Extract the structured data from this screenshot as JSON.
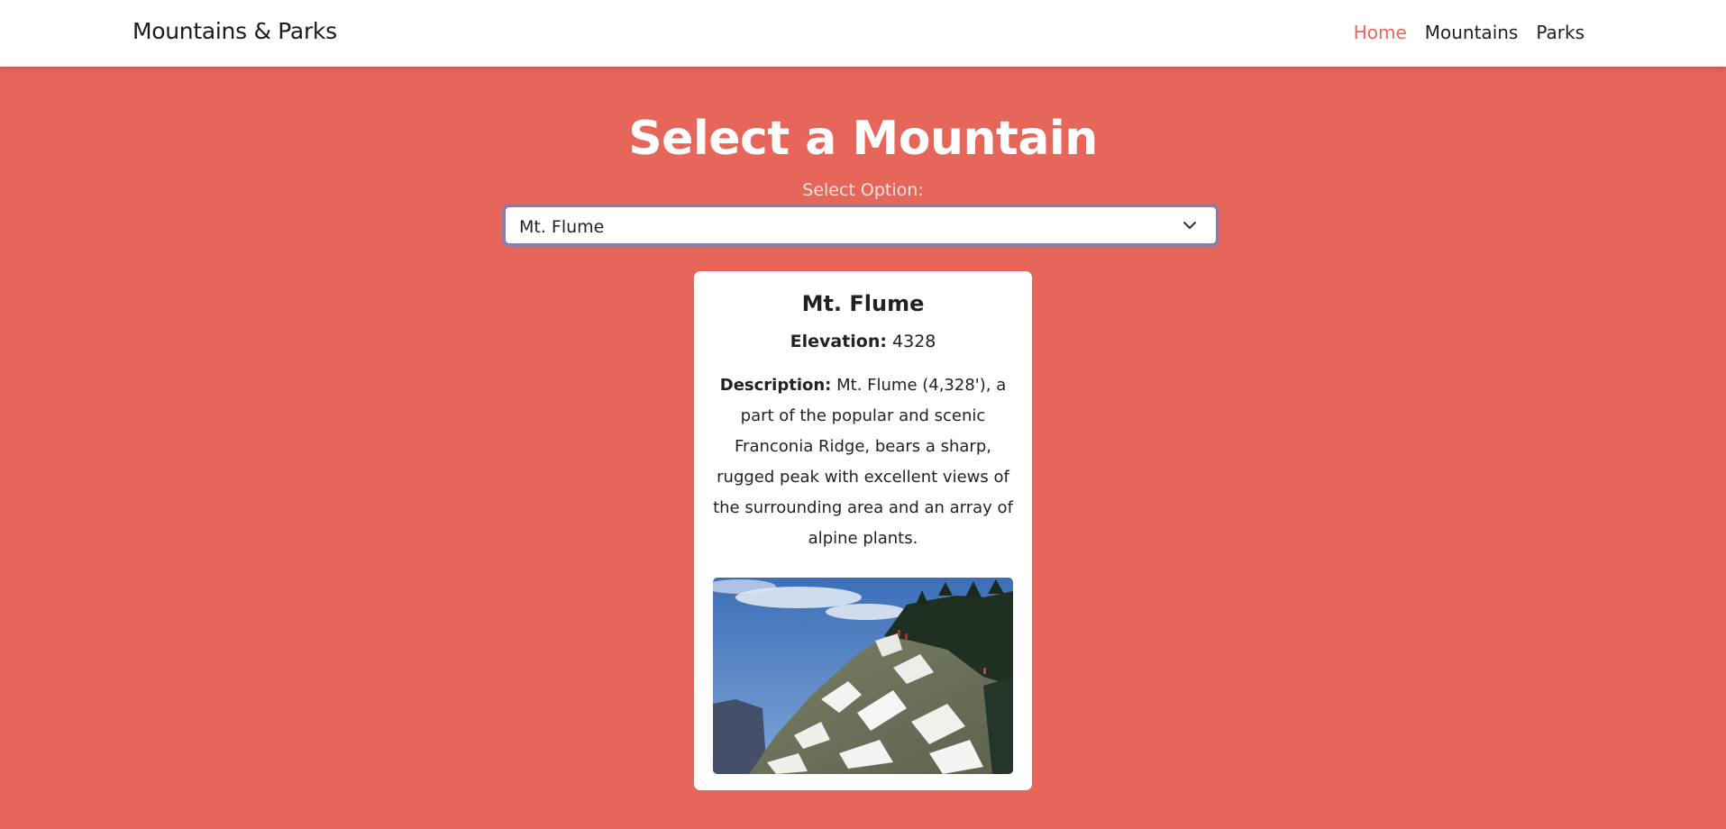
{
  "navbar": {
    "brand": "Mountains & Parks",
    "links": [
      {
        "label": "Home",
        "active": true
      },
      {
        "label": "Mountains",
        "active": false
      },
      {
        "label": "Parks",
        "active": false
      }
    ]
  },
  "main": {
    "title": "Select a Mountain",
    "select_label": "Select Option:",
    "selected_value": "Mt. Flume"
  },
  "card": {
    "name": "Mt. Flume",
    "elevation_label": "Elevation:",
    "elevation_value": "4328",
    "description_label": "Description:",
    "description_text": "Mt. Flume (4,328'), a part of the popular and scenic Franconia Ridge, bears a sharp, rugged peak with excellent views of the surrounding area and an array of alpine plants."
  },
  "colors": {
    "accent": "#e6675a",
    "card_bg": "#ffffff",
    "select_border": "#8a7aa6"
  },
  "icons": {
    "select": "chevron-down-icon",
    "photo": "mountain-photo"
  }
}
